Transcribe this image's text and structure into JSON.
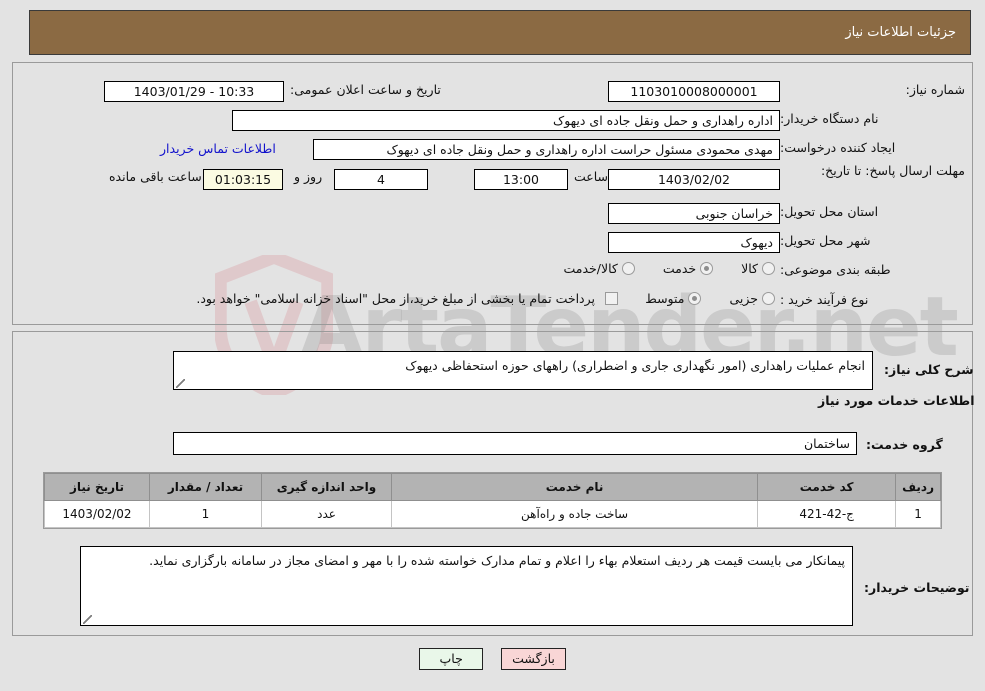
{
  "header": {
    "title": "جزئیات اطلاعات نیاز"
  },
  "watermark": {
    "text": "ArtaTender.net",
    "logo_name": "shield-logo"
  },
  "form": {
    "need_number_label": "شماره نیاز:",
    "need_number_value": "1103010008000001",
    "public_announce_label": "تاریخ و ساعت اعلان عمومی:",
    "public_announce_value": "1403/01/29 - 10:33",
    "buyer_org_label": "نام دستگاه خریدار:",
    "buyer_org_value": "اداره راهداری و حمل ونقل جاده ای دیهوک",
    "request_creator_label": "ایجاد کننده درخواست:",
    "request_creator_value": "مهدی محمودی مسئول حراست اداره راهداری و حمل ونقل جاده ای دیهوک",
    "buyer_contact_link": "اطلاعات تماس خریدار",
    "deadline_label": "مهلت ارسال پاسخ: تا تاریخ:",
    "deadline_date": "1403/02/02",
    "hour_label": "ساعت",
    "deadline_time": "13:00",
    "days_value": "4",
    "days_label": "روز و",
    "countdown_value": "01:03:15",
    "remaining_label": "ساعت باقی مانده",
    "province_label": "استان محل تحویل:",
    "province_value": "خراسان جنوبی",
    "city_label": "شهر محل تحویل:",
    "city_value": "دیهوک",
    "category_label": "طبقه بندی موضوعی:",
    "category_options": [
      {
        "label": "کالا",
        "selected": false
      },
      {
        "label": "خدمت",
        "selected": true
      },
      {
        "label": "کالا/خدمت",
        "selected": false
      }
    ],
    "process_label": "نوع فرآیند خرید :",
    "process_options": [
      {
        "label": "جزیی",
        "selected": false
      },
      {
        "label": "متوسط",
        "selected": true
      }
    ],
    "treasury_checkbox_label": "پرداخت تمام یا بخشی از مبلغ خرید،از محل \"اسناد خزانه اسلامی\" خواهد بود.",
    "treasury_checked": false
  },
  "need": {
    "general_desc_label": "شرح کلی نیاز:",
    "general_desc_value": "انجام عملیات راهداری (امور نگهداری جاری و اضطراری) راههای حوزه استحفاظی دیهوک",
    "services_info_title": "اطلاعات خدمات مورد نیاز",
    "service_group_label": "گروه خدمت:",
    "service_group_value": "ساختمان"
  },
  "table": {
    "headers": [
      "ردیف",
      "کد خدمت",
      "نام خدمت",
      "واحد اندازه گیری",
      "تعداد / مقدار",
      "تاریخ نیاز"
    ],
    "rows": [
      {
        "row_no": "1",
        "service_code": "ج-42-421",
        "service_name": "ساخت جاده و راه‌آهن",
        "unit": "عدد",
        "quantity": "1",
        "need_date": "1403/02/02"
      }
    ]
  },
  "comments": {
    "label": "توضیحات خریدار:",
    "value": "پیمانکار می بایست قیمت هر ردیف استعلام بهاء را اعلام و تمام مدارک خواسته شده را با مهر و امضای مجاز در سامانه بارگزاری نماید."
  },
  "footer": {
    "print_label": "چاپ",
    "back_label": "بازگشت"
  },
  "colors": {
    "header_bg": "#8b6a43",
    "page_bg": "#e3e3e3",
    "link": "#1111cc",
    "badge_bg": "#fbfbe2",
    "table_header_bg": "#b3b3b3",
    "btn_print_bg": "#e9f7e9",
    "btn_back_bg": "#f9d6d6"
  }
}
